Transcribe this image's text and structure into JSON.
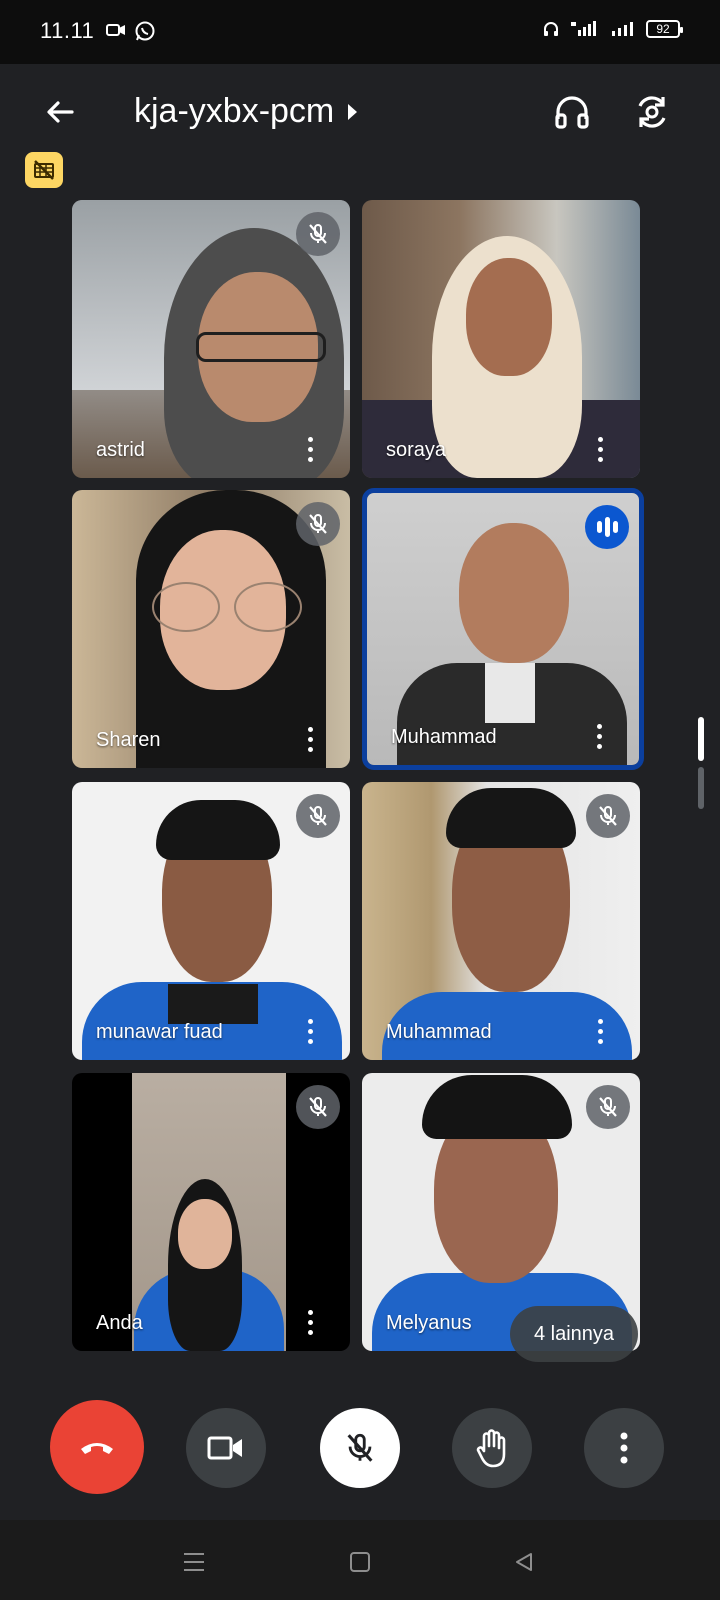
{
  "status_bar": {
    "time": "11.11",
    "battery": "92"
  },
  "app_bar": {
    "meeting_code": "kja-yxbx-pcm"
  },
  "participants": [
    {
      "name": "astrid"
    },
    {
      "name": "soraya"
    },
    {
      "name": "Sharen"
    },
    {
      "name": "Muhammad"
    },
    {
      "name": "munawar fuad"
    },
    {
      "name": "Muhammad"
    },
    {
      "name": "Anda"
    },
    {
      "name": "Melyanus"
    }
  ],
  "more_participants_label": "4 lainnya",
  "colors": {
    "end_call": "#ea4335",
    "active_speaker": "#0b57d0",
    "badge": "#fdd663"
  }
}
